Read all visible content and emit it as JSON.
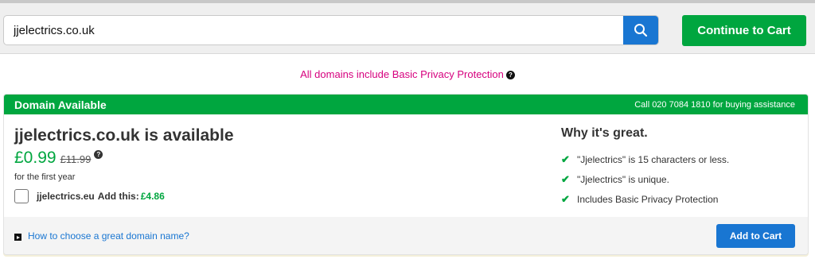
{
  "search": {
    "value": "jjelectrics.co.uk",
    "button_icon": "search-icon"
  },
  "continue_button": {
    "label": "Continue to Cart"
  },
  "privacy_note": {
    "text": "All domains include Basic Privacy Protection"
  },
  "card": {
    "header_title": "Domain Available",
    "header_phone": "Call 020 7084 1810 for buying assistance",
    "domain_headline": "jjelectrics.co.uk is available",
    "price": "£0.99",
    "old_price": "£11.99",
    "term": "for the first year",
    "addon": {
      "domain": "jjelectrics.eu",
      "label": "Add this:",
      "price": "£4.86"
    },
    "why": {
      "title": "Why it's great.",
      "items": [
        "\"Jjelectrics\" is 15 characters or less.",
        "\"Jjelectrics\" is unique.",
        "Includes Basic Privacy Protection"
      ]
    },
    "footer": {
      "guide_link": "How to choose a great domain name?",
      "add_to_cart": "Add to Cart"
    }
  },
  "colors": {
    "green": "#00a63f",
    "blue": "#1976d2",
    "pink": "#d6007e"
  }
}
